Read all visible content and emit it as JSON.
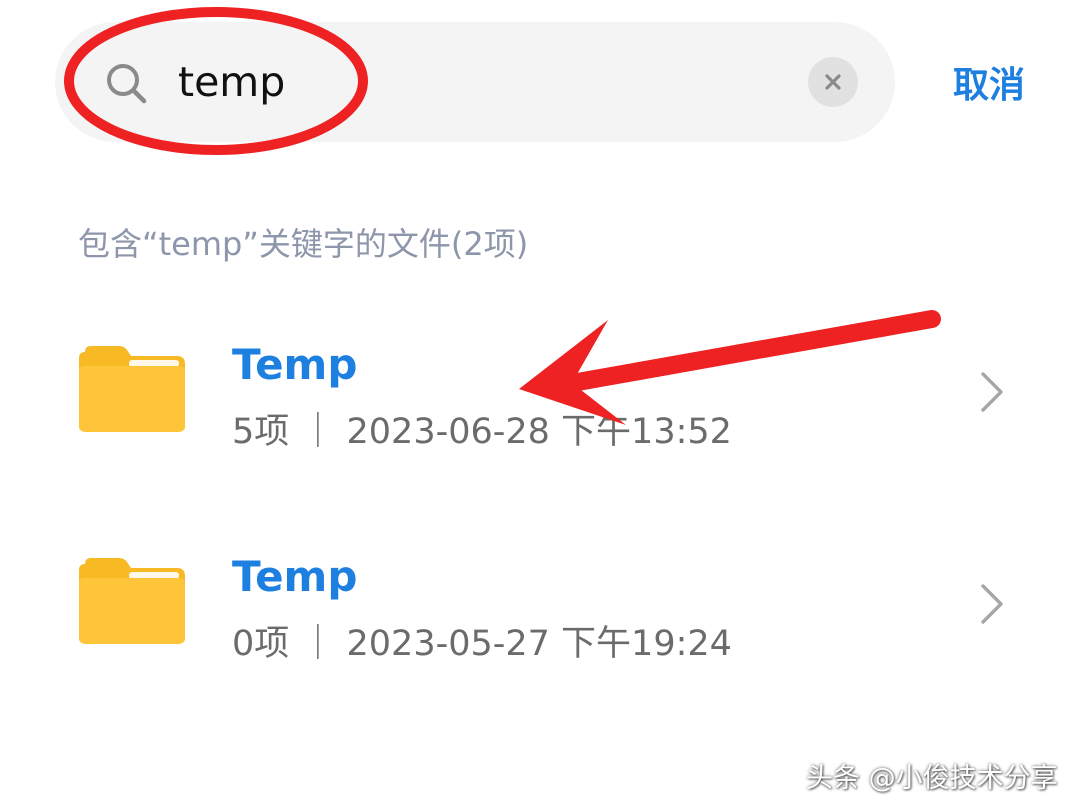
{
  "search": {
    "value": "temp",
    "cancel_label": "取消",
    "icon": "search-icon",
    "clear_icon": "close-icon"
  },
  "results": {
    "heading": "包含“temp”关键字的文件(2项)",
    "items": [
      {
        "name": "Temp",
        "meta": "5项 ｜ 2023-06-28 下午13:52",
        "icon": "folder-icon"
      },
      {
        "name": "Temp",
        "meta": "0项 ｜ 2023-05-27 下午19:24",
        "icon": "folder-icon"
      }
    ]
  },
  "watermark": "头条 @小俊技术分享",
  "colors": {
    "accent": "#1d7fdf",
    "folder": "#fbc02d",
    "annotation": "#ee2222"
  }
}
